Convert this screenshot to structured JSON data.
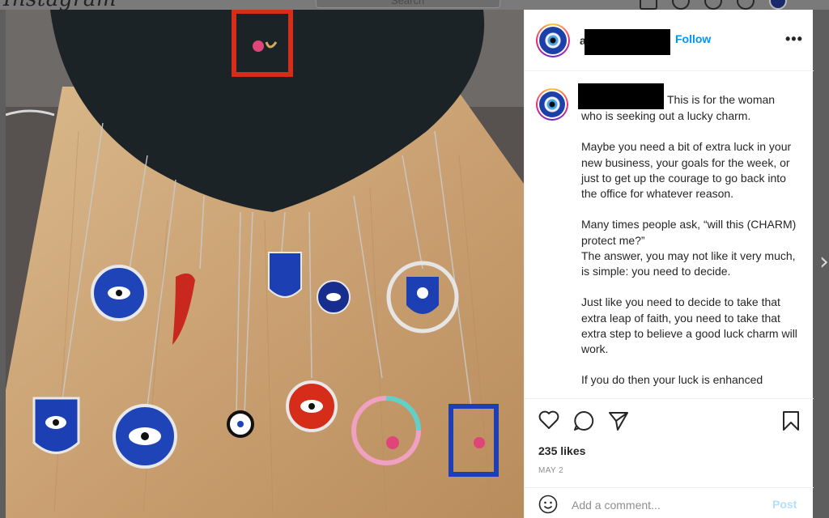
{
  "topbar": {
    "brand": "Instagram",
    "search_placeholder": "Search",
    "nav_icons": [
      "home-icon",
      "messenger-icon",
      "explore-icon",
      "avatar"
    ]
  },
  "post": {
    "header": {
      "username_initial": "a",
      "follow_label": "Follow",
      "more_label": "•••"
    },
    "caption": {
      "first_line": "This is for the woman",
      "paragraphs": [
        "who is seeking out a lucky charm.",
        "Maybe you need a bit of extra luck in your new business, your goals for the week, or just to get up the courage to go back into the office for whatever reason.",
        "Many times people ask, “will this (CHARM) protect me?”\nThe answer, you may not like it very much, is simple: you need to decide.",
        "Just like you need to decide to take that extra leap of faith, you need to take that extra step to believe a good luck charm will work.",
        "If you do then your luck is enhanced"
      ]
    },
    "actions": {
      "icons": [
        "heart-icon",
        "comment-icon",
        "share-icon",
        "bookmark-icon"
      ],
      "likes": "235 likes",
      "date": "MAY 2"
    },
    "comment": {
      "placeholder": "Add a comment...",
      "post_label": "Post"
    }
  },
  "nav": {
    "next_arrow": "›"
  },
  "colors": {
    "link_blue": "#0095f6",
    "post_disabled": "#b2dffc",
    "meta_gray": "#8e8e8e",
    "text": "#262626"
  }
}
